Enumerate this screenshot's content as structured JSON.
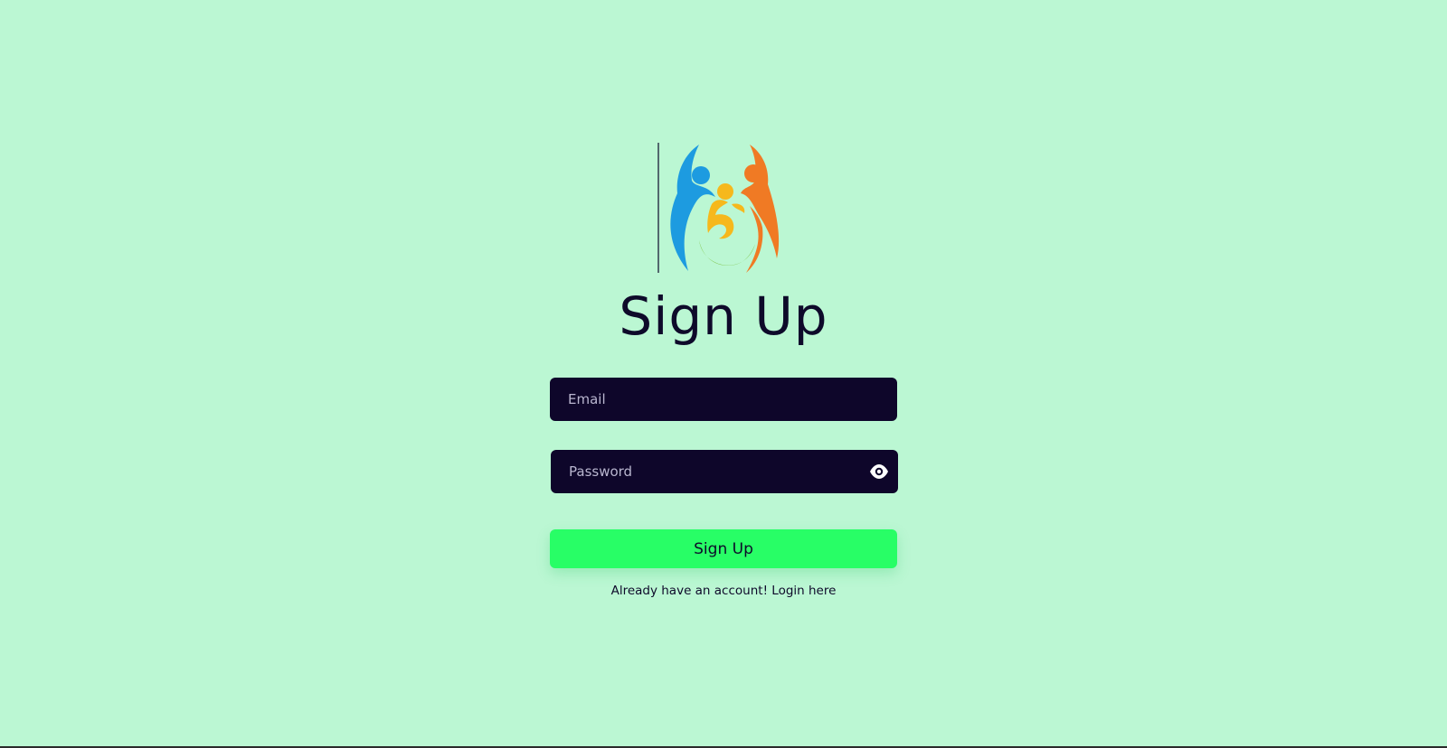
{
  "logo": {
    "icon": "inclusive-people-logo",
    "colors": {
      "blue": "#1d9be0",
      "orange": "#f07a24",
      "yellow": "#f6b81c",
      "green": "#7cc142"
    }
  },
  "heading": "Sign Up",
  "form": {
    "email_placeholder": "Email",
    "email_value": "",
    "password_placeholder": "Password",
    "password_value": "",
    "password_toggle_icon": "eye-icon",
    "submit_label": "Sign Up"
  },
  "footer": {
    "prompt": "Already have an account!",
    "link": "Login here"
  },
  "theme": {
    "background": "#bbf7d3",
    "field_background": "#0e062a",
    "button_background": "#28fe66",
    "text_color": "#0e0a2a"
  }
}
